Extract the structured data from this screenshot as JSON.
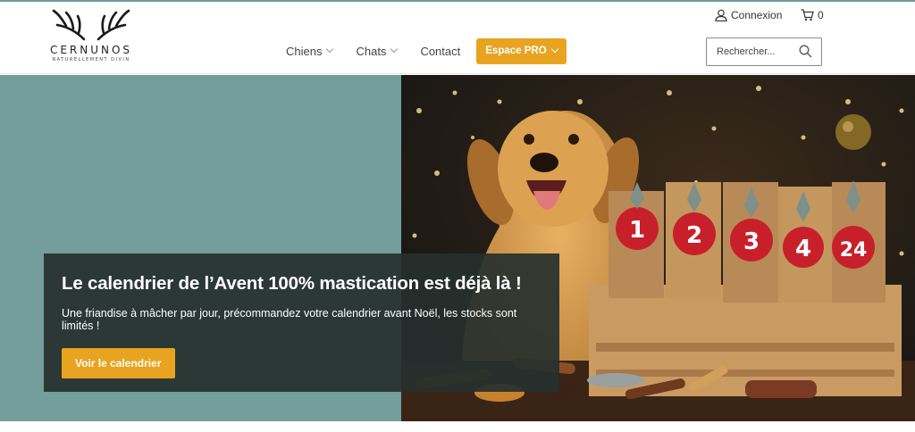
{
  "brand": {
    "name": "CERNUNOS",
    "tagline": "NATURELLEMENT DIVIN"
  },
  "nav": {
    "items": [
      {
        "label": "Chiens",
        "has_dropdown": true
      },
      {
        "label": "Chats",
        "has_dropdown": true
      },
      {
        "label": "Contact",
        "has_dropdown": false
      }
    ],
    "pro_label": "Espace PRO"
  },
  "account": {
    "login_label": "Connexion",
    "cart_count": "0"
  },
  "search": {
    "placeholder": "Rechercher..."
  },
  "hero": {
    "title": "Le calendrier de l’Avent 100% mastication est déjà là !",
    "subtitle": "Une friandise à mâcher par jour, précommandez votre calendrier avant Noël, les stocks sont limités !",
    "cta_label": "Voir le calendrier",
    "image_icon": "dog-advent-calendar-photo",
    "bag_numbers": [
      "1",
      "2",
      "3",
      "4",
      "24"
    ]
  },
  "colors": {
    "accent": "#e8a420",
    "hero_bg": "#739e9b",
    "banner_bg": "#26302e"
  }
}
